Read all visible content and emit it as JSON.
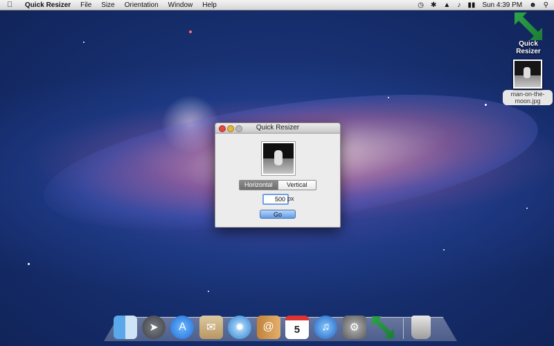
{
  "menubar": {
    "app_name": "Quick Resizer",
    "menus": [
      "File",
      "Size",
      "Orientation",
      "Window",
      "Help"
    ],
    "clock": "Sun 4:39 PM"
  },
  "desktop": {
    "app_icon_label": "Quick Resizer",
    "file_icon_label": "man-on-the-moon.jpg"
  },
  "window": {
    "title": "Quick Resizer",
    "orientation": {
      "options": [
        "Horizontal",
        "Vertical"
      ],
      "selected": "Horizontal"
    },
    "size_value": "500",
    "size_unit": "px",
    "go_label": "Go"
  },
  "dock": {
    "calendar_day": "5",
    "items": [
      "finder-icon",
      "launchpad-icon",
      "app-store-icon",
      "mail-icon",
      "safari-icon",
      "address-book-icon",
      "ical-icon",
      "itunes-icon",
      "system-preferences-icon",
      "quick-resizer-icon",
      "trash-icon"
    ]
  }
}
